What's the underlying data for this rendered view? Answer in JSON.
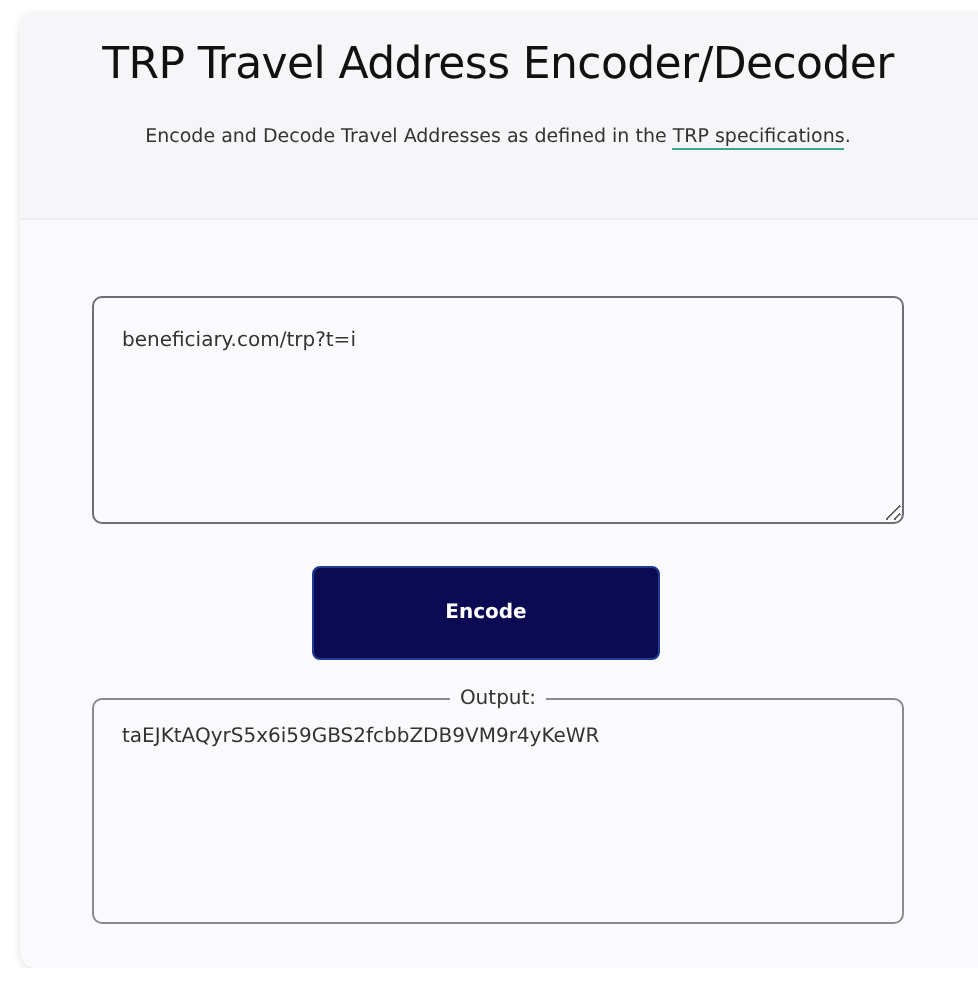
{
  "header": {
    "title": "TRP Travel Address Encoder/Decoder",
    "subtitle": "Encode and Decode Travel Addresses as defined in the ",
    "link": "TRP specifications",
    "subtitle_end": "."
  },
  "input": {
    "value": "beneficiary.com/trp?t=i"
  },
  "button": {
    "label": "Encode"
  },
  "output": {
    "legend": "Output:",
    "value": "taEJKtAQyrS5x6i59GBS2fcbbZDB9VM9r4yKeWR"
  }
}
